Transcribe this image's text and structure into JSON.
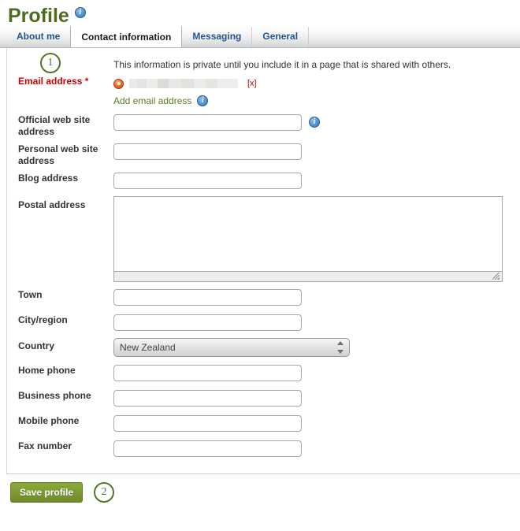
{
  "page": {
    "title": "Profile",
    "title_info_icon": "info-icon"
  },
  "tabs": [
    {
      "label": "About me",
      "active": false
    },
    {
      "label": "Contact information",
      "active": true
    },
    {
      "label": "Messaging",
      "active": false
    },
    {
      "label": "General",
      "active": false
    }
  ],
  "steps": {
    "one": "1",
    "two": "2"
  },
  "notice": "This information is private until you include it in a page that is shared with others.",
  "email": {
    "label": "Email address *",
    "radio_selected": true,
    "value_masked": "",
    "remove_label": "[x]",
    "add_label": "Add email address",
    "add_info_icon": "info-icon"
  },
  "fields": [
    {
      "label": "Official web site address",
      "name": "official-web-site-address",
      "type": "text",
      "value": "",
      "placeholder": "",
      "info_icon": "info-icon"
    },
    {
      "label": "Personal web site address",
      "name": "personal-web-site-address",
      "type": "text",
      "value": "",
      "placeholder": ""
    },
    {
      "label": "Blog address",
      "name": "blog-address",
      "type": "text",
      "value": "",
      "placeholder": ""
    },
    {
      "label": "Postal address",
      "name": "postal-address",
      "type": "textarea",
      "value": "",
      "placeholder": ""
    },
    {
      "label": "Town",
      "name": "town",
      "type": "text",
      "value": "",
      "placeholder": ""
    },
    {
      "label": "City/region",
      "name": "city-region",
      "type": "text",
      "value": "",
      "placeholder": ""
    },
    {
      "label": "Country",
      "name": "country",
      "type": "select",
      "value": "New Zealand",
      "options": [
        "New Zealand"
      ]
    },
    {
      "label": "Home phone",
      "name": "home-phone",
      "type": "text",
      "value": "",
      "placeholder": ""
    },
    {
      "label": "Business phone",
      "name": "business-phone",
      "type": "text",
      "value": "",
      "placeholder": ""
    },
    {
      "label": "Mobile phone",
      "name": "mobile-phone",
      "type": "text",
      "value": "",
      "placeholder": ""
    },
    {
      "label": "Fax number",
      "name": "fax-number",
      "type": "text",
      "value": "",
      "placeholder": ""
    }
  ],
  "footer": {
    "save_label": "Save profile"
  },
  "colors": {
    "title_green": "#4e6b1f",
    "link_green": "#5b7f22",
    "required_red": "#cc0000",
    "tab_blue": "#22558c",
    "button_green": "#7d9a33",
    "radio_orange": "#e8641d"
  }
}
